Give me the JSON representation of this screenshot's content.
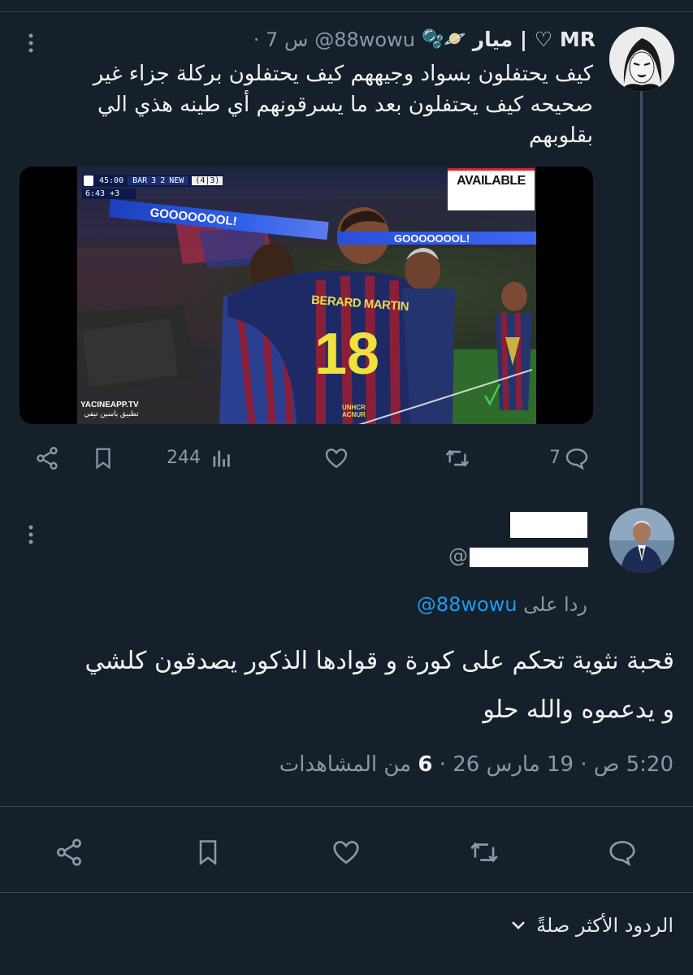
{
  "tweet": {
    "display_name": "MR ♡ | ميار",
    "emojis": "🫧🪐",
    "handle": "@88wowu",
    "time": "· 7 س",
    "text_lines": [
      "كيف يحتفلون بسواد وجيههم كيف يحتفلون بركلة جزاء غير",
      "صحيحه كيف يحتفلون بعد ما يسرقونهم أي طينه هذي الي",
      "بقلوبهم"
    ],
    "media": {
      "scoreboard": {
        "clock": "45:00",
        "extra": "6:43",
        "plus": "+3",
        "home": "BAR",
        "home_score": "3",
        "away_score": "2",
        "away": "NEW",
        "agg": "(4|3)"
      },
      "available_label": "AVAILABLE",
      "banner_left": "GOOOOOOOL!",
      "banner_right": "GOOOOOOOL!",
      "shirt_name": "BERARD MARTIN",
      "shirt_number": "18",
      "watermark_line1": "YACINEAPP.TV",
      "watermark_line2": "تطبيق ياسين تيفي",
      "sponsor": "UNHCR ACNUR"
    },
    "actions": {
      "views": "244",
      "replies": "7"
    }
  },
  "reply": {
    "handle_prefix": "@",
    "replying_to_label": "ردا على",
    "replying_to_handle": "@88wowu",
    "text_lines": [
      "قحبة نثوية تحكم على كورة و قوادها الذكور يصدقون كلشي",
      "و يدعموه والله حلو"
    ],
    "meta_time": "5:20 ص · 19 مارس 26 ·",
    "meta_views_count": "6",
    "meta_views_label": "من المشاهدات"
  },
  "footer": {
    "sort_label": "الردود الأكثر صلةً"
  },
  "colors": {
    "bg": "#15202b",
    "text": "#e7e9ea",
    "muted": "#8b98a5",
    "accent": "#1d9bf0",
    "divider": "#38444d"
  }
}
